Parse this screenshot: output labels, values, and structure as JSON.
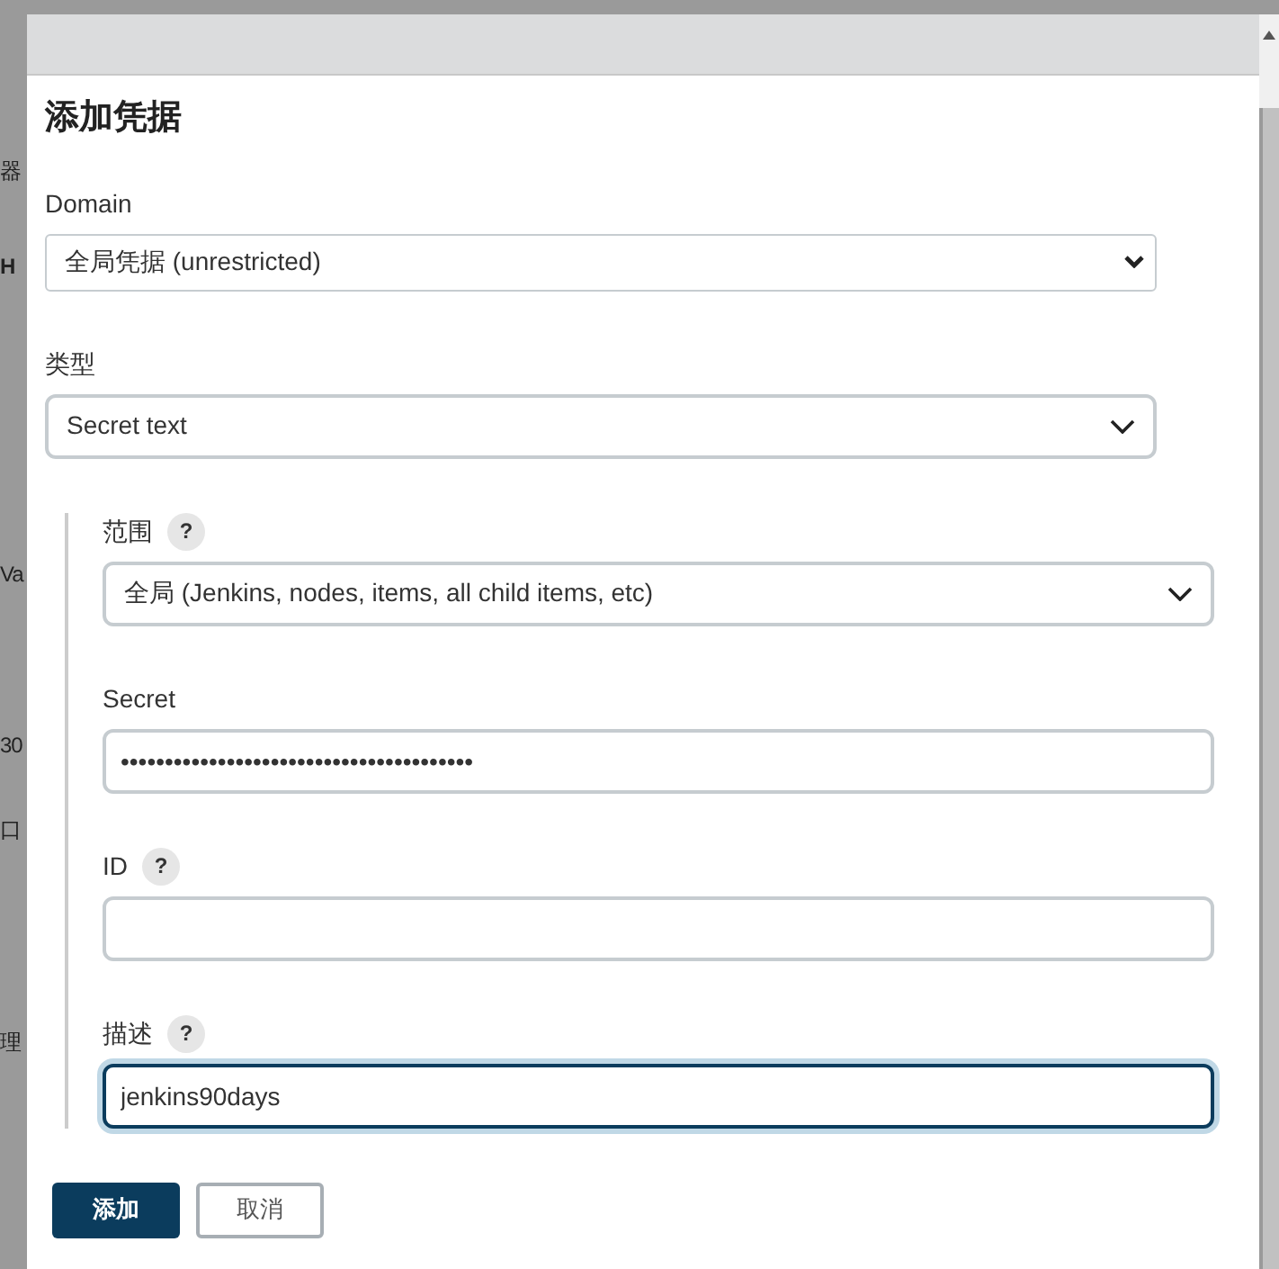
{
  "background_fragments": [
    "器",
    "H",
    "Va",
    "30",
    "口",
    "理"
  ],
  "dialog": {
    "title": "添加凭据",
    "fields": [
      {
        "kind": "native-select",
        "label": "Domain",
        "help": false,
        "value": "全局凭据 (unrestricted)",
        "focused": false
      },
      {
        "kind": "select",
        "label": "类型",
        "help": false,
        "value": "Secret text",
        "focused": false
      }
    ],
    "nested_fields": [
      {
        "kind": "select",
        "label": "范围",
        "help": true,
        "value": "全局 (Jenkins, nodes, items, all child items, etc)",
        "focused": false
      },
      {
        "kind": "text",
        "label": "Secret",
        "help": false,
        "value": "••••••••••••••••••••••••••••••••••••••••",
        "focused": false
      },
      {
        "kind": "text",
        "label": "ID",
        "help": true,
        "focused": false
      },
      {
        "kind": "text",
        "label": "描述",
        "help": true,
        "value": "jenkins90days",
        "focused": true
      }
    ],
    "help_mark": "?",
    "buttons": [
      {
        "label": "添加",
        "kind": "primary"
      },
      {
        "label": "取消",
        "kind": "secondary"
      }
    ]
  }
}
